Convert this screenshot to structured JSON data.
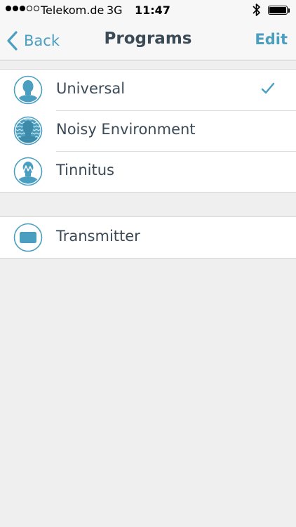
{
  "status_bar": {
    "signal": "●●●○○",
    "carrier": "Telekom.de",
    "network": "3G",
    "time": "11:47",
    "bluetooth_icon": "bluetooth-icon",
    "battery_level": 1.0
  },
  "nav": {
    "back_label": "Back",
    "title": "Programs",
    "edit_label": "Edit"
  },
  "programs": [
    {
      "label": "Universal",
      "icon": "person-head-icon",
      "selected": true
    },
    {
      "label": "Noisy Environment",
      "icon": "person-noise-icon",
      "selected": false
    },
    {
      "label": "Tinnitus",
      "icon": "person-tinnitus-icon",
      "selected": false
    }
  ],
  "transmitter": {
    "label": "Transmitter",
    "icon": "transmitter-icon"
  },
  "colors": {
    "accent": "#4a9fc0",
    "text": "#3b4a57",
    "background": "#efefef"
  }
}
